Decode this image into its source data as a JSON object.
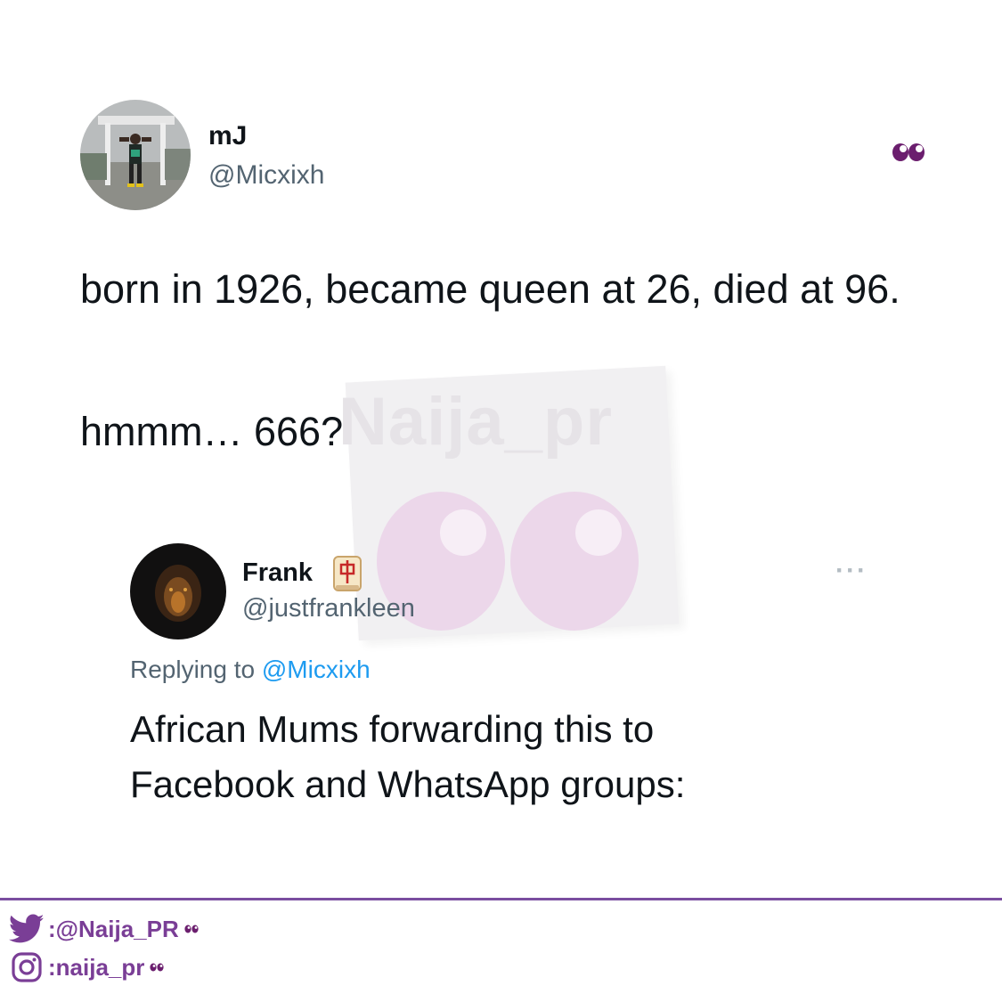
{
  "tweet": {
    "author_name": "mJ",
    "author_handle": "@Micxixh",
    "text_line1": "born in 1926, became queen at 26, died at 96.",
    "text_line2": "hmmm… 666?",
    "header_icon": "eyes-emoji-icon"
  },
  "reply": {
    "author_name": "Frank",
    "author_badge_icon": "mahjong-red-dragon-icon",
    "author_handle": "@justfrankleen",
    "replying_prefix": "Replying to",
    "replying_to": "@Micxixh",
    "text": "African Mums forwarding this to Facebook and WhatsApp groups:",
    "more_icon": "more-options-icon"
  },
  "watermark": {
    "text": "Naija_pr"
  },
  "footer": {
    "twitter_handle": ":@Naija_PR",
    "instagram_handle": ":naija_pr",
    "accent_color": "#7a3e96"
  },
  "colors": {
    "handle": "#536471",
    "mention": "#1d9bf0",
    "text": "#0f1419",
    "eyes": "#6b1e6e"
  }
}
